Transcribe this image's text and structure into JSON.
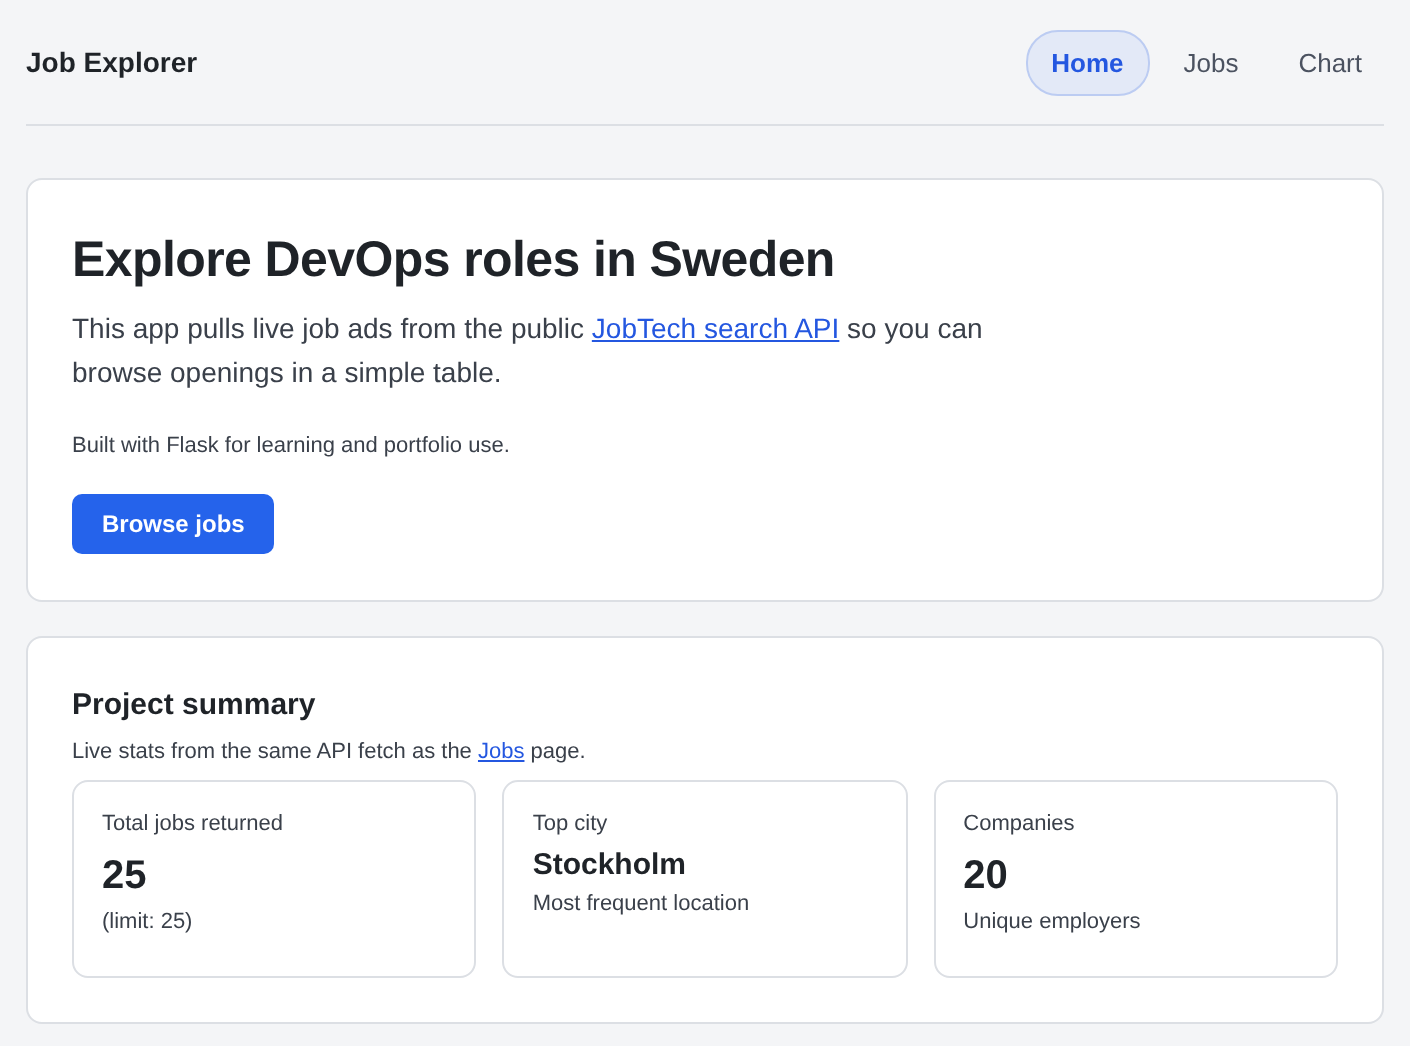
{
  "header": {
    "brand": "Job Explorer",
    "nav": [
      {
        "label": "Home",
        "selected": true
      },
      {
        "label": "Jobs",
        "selected": false
      },
      {
        "label": "Chart",
        "selected": false
      }
    ]
  },
  "hero": {
    "title": "Explore DevOps roles in Sweden",
    "intro": {
      "before": "This app pulls live job ads from the public ",
      "link": "JobTech search API",
      "after": " so you can browse openings in a simple table."
    },
    "note": "Built with Flask for learning and portfolio use.",
    "button": "Browse jobs"
  },
  "summary": {
    "title": "Project summary",
    "subtitle": {
      "before": "Live stats from the same API fetch as the ",
      "link": "Jobs",
      "after": " page."
    },
    "stats": [
      {
        "kind": "number",
        "label": "Total jobs returned",
        "value": "25",
        "caption": "(limit: 25)"
      },
      {
        "kind": "text",
        "label": "Top city",
        "value": "Stockholm",
        "caption": "Most frequent location"
      },
      {
        "kind": "number",
        "label": "Companies",
        "value": "20",
        "caption": "Unique employers"
      }
    ]
  }
}
